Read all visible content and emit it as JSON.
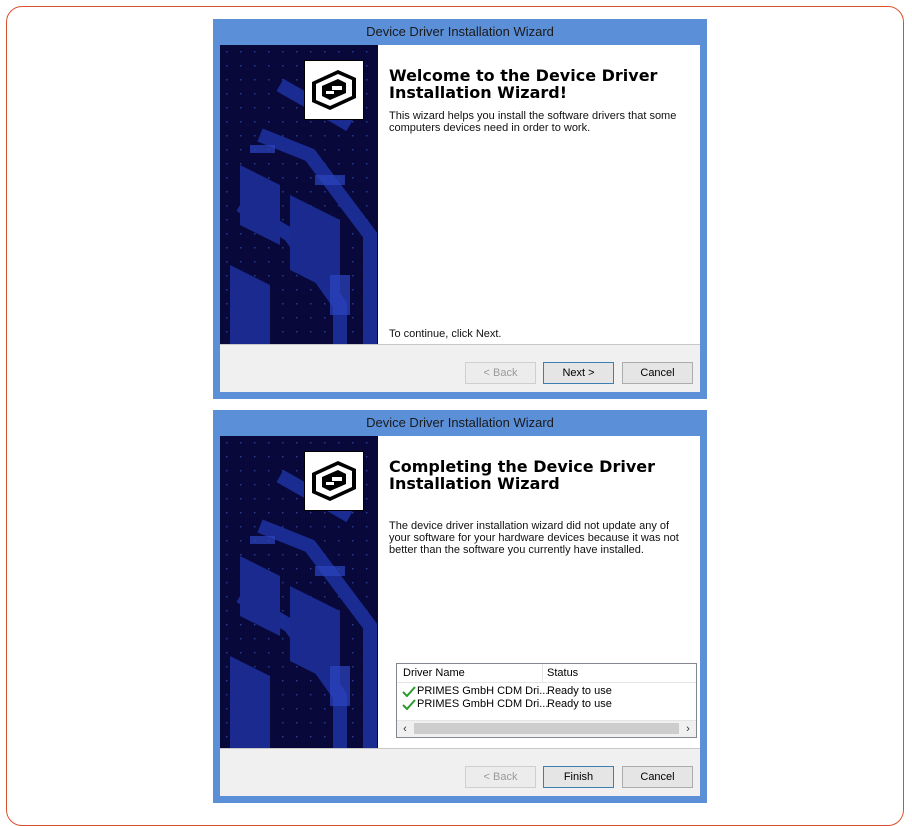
{
  "wizard1": {
    "title": "Device Driver Installation Wizard",
    "heading": "Welcome to the Device Driver Installation Wizard!",
    "description": "This wizard helps you install the software drivers that some computers devices need in order to work.",
    "continue_text": "To continue, click Next.",
    "buttons": {
      "back": "< Back",
      "next": "Next >",
      "cancel": "Cancel"
    }
  },
  "wizard2": {
    "title": "Device Driver Installation Wizard",
    "heading": "Completing the Device Driver Installation Wizard",
    "description": "The device driver installation wizard did not update any of your software for your hardware devices because it was not better than the software you currently have installed.",
    "table": {
      "columns": [
        "Driver Name",
        "Status"
      ],
      "rows": [
        {
          "name": "PRIMES GmbH CDM Dri...",
          "status": "Ready to use"
        },
        {
          "name": "PRIMES GmbH CDM Dri...",
          "status": "Ready to use"
        }
      ]
    },
    "buttons": {
      "back": "< Back",
      "finish": "Finish",
      "cancel": "Cancel"
    }
  },
  "icons": {
    "wizard_icon": "hardware-install-icon",
    "row_check": "checkmark-icon",
    "scroll_left": "chevron-left-icon",
    "scroll_right": "chevron-right-icon"
  },
  "colors": {
    "frame_border": "#d9502e",
    "titlebar": "#5b8fd8",
    "side_panel": "#08083a",
    "check": "#2c9a2c"
  }
}
